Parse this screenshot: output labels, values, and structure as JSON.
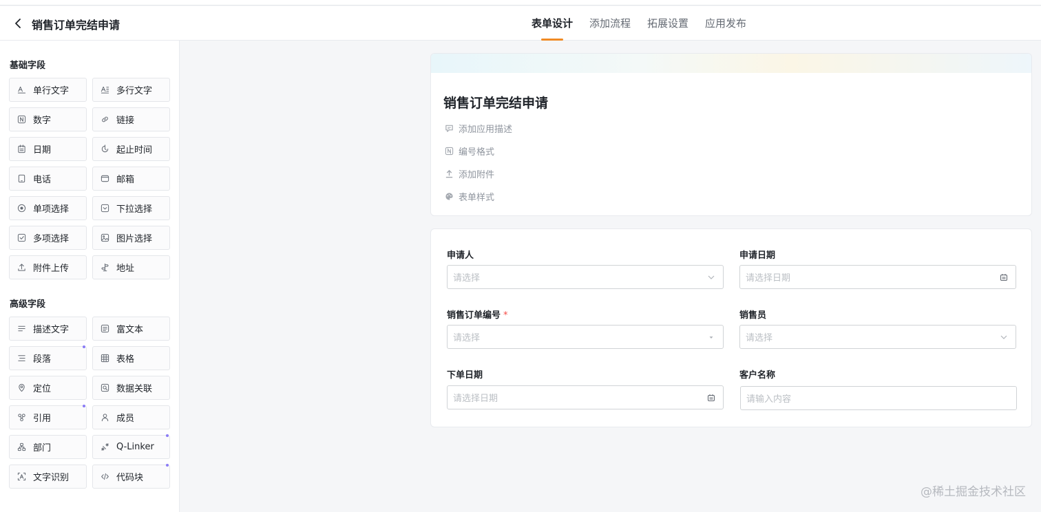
{
  "header": {
    "app_title": "销售订单完结申请",
    "tabs": [
      {
        "label": "表单设计",
        "active": true
      },
      {
        "label": "添加流程",
        "active": false
      },
      {
        "label": "拓展设置",
        "active": false
      },
      {
        "label": "应用发布",
        "active": false
      }
    ]
  },
  "sidebar": {
    "basic_title": "基础字段",
    "basic_fields": [
      {
        "label": "单行文字",
        "icon": "single-line-text-icon"
      },
      {
        "label": "多行文字",
        "icon": "multi-line-text-icon"
      },
      {
        "label": "数字",
        "icon": "number-icon"
      },
      {
        "label": "链接",
        "icon": "link-icon"
      },
      {
        "label": "日期",
        "icon": "calendar-icon"
      },
      {
        "label": "起止时间",
        "icon": "time-range-icon"
      },
      {
        "label": "电话",
        "icon": "phone-icon"
      },
      {
        "label": "邮箱",
        "icon": "mail-icon"
      },
      {
        "label": "单项选择",
        "icon": "radio-icon"
      },
      {
        "label": "下拉选择",
        "icon": "dropdown-icon"
      },
      {
        "label": "多项选择",
        "icon": "checkbox-icon"
      },
      {
        "label": "图片选择",
        "icon": "image-icon"
      },
      {
        "label": "附件上传",
        "icon": "upload-icon"
      },
      {
        "label": "地址",
        "icon": "address-icon"
      }
    ],
    "advanced_title": "高级字段",
    "advanced_fields": [
      {
        "label": "描述文字",
        "icon": "description-icon"
      },
      {
        "label": "富文本",
        "icon": "rich-text-icon"
      },
      {
        "label": "段落",
        "icon": "paragraph-icon"
      },
      {
        "label": "表格",
        "icon": "table-icon"
      },
      {
        "label": "定位",
        "icon": "location-icon"
      },
      {
        "label": "数据关联",
        "icon": "data-link-icon"
      },
      {
        "label": "引用",
        "icon": "reference-icon"
      },
      {
        "label": "成员",
        "icon": "member-icon"
      },
      {
        "label": "部门",
        "icon": "department-icon"
      },
      {
        "label": "Q-Linker",
        "icon": "q-linker-icon"
      },
      {
        "label": "文字识别",
        "icon": "ocr-icon"
      },
      {
        "label": "代码块",
        "icon": "code-icon"
      }
    ]
  },
  "form_header": {
    "title": "销售订单完结申请",
    "add_description": "添加应用描述",
    "number_format": "编号格式",
    "add_attachment": "添加附件",
    "form_style": "表单样式"
  },
  "form_fields": {
    "applicant": {
      "label": "申请人",
      "placeholder": "请选择"
    },
    "apply_date": {
      "label": "申请日期",
      "placeholder": "请选择日期"
    },
    "order_number": {
      "label": "销售订单编号",
      "required_mark": "*",
      "placeholder": "请选择"
    },
    "salesperson": {
      "label": "销售员",
      "placeholder": "请选择"
    },
    "order_date": {
      "label": "下单日期",
      "placeholder": "请选择日期"
    },
    "customer_name": {
      "label": "客户名称",
      "placeholder": "请输入内容"
    }
  },
  "watermark": "@稀土掘金技术社区",
  "colors": {
    "accent": "#f08a24",
    "required": "#f54a45",
    "new_dot": "#8b7cf6"
  }
}
